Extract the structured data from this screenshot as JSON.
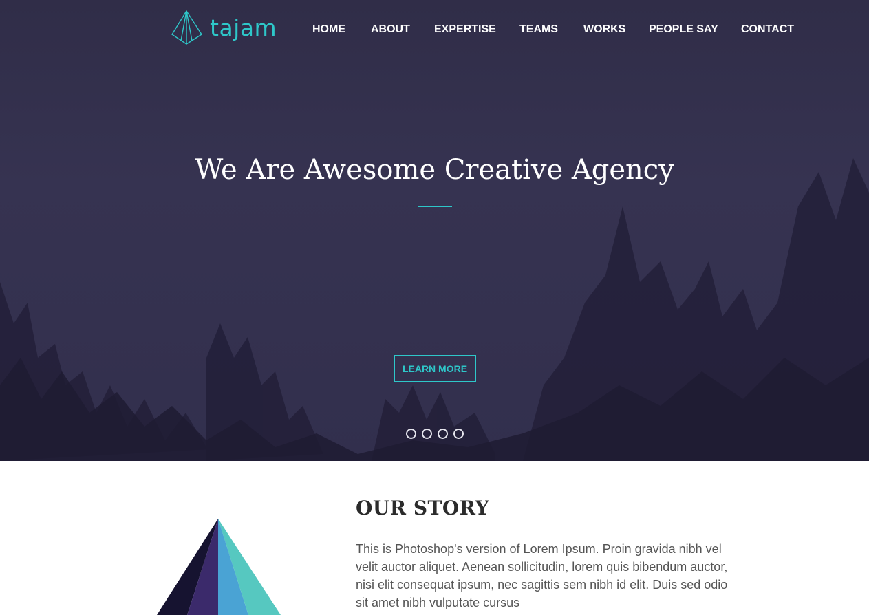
{
  "brand": {
    "name": "tajam",
    "logo_icon": "pyramid-logo-icon",
    "accent_color": "#2ec7c9"
  },
  "nav": {
    "items": [
      {
        "label": "HOME"
      },
      {
        "label": "ABOUT"
      },
      {
        "label": "EXPERTISE"
      },
      {
        "label": "TEAMS"
      },
      {
        "label": "WORKS"
      },
      {
        "label": "PEOPLE SAY"
      },
      {
        "label": "CONTACT"
      }
    ]
  },
  "hero": {
    "title": "We Are Awesome Creative Agency",
    "button_label": "LEARN MORE",
    "slides": 4,
    "background_color": "#322f4d"
  },
  "story": {
    "title": "OUR STORY",
    "text": "This is Photoshop's version of Lorem Ipsum. Proin gravida nibh vel velit auctor aliquet. Aenean sollicitudin, lorem quis bibendum auctor, nisi elit consequat ipsum, nec sagittis sem nibh id elit. Duis sed odio sit amet nibh vulputate cursus",
    "illustration_colors": [
      "#161330",
      "#3b2a6b",
      "#4aa3d4",
      "#56c8c0"
    ]
  }
}
